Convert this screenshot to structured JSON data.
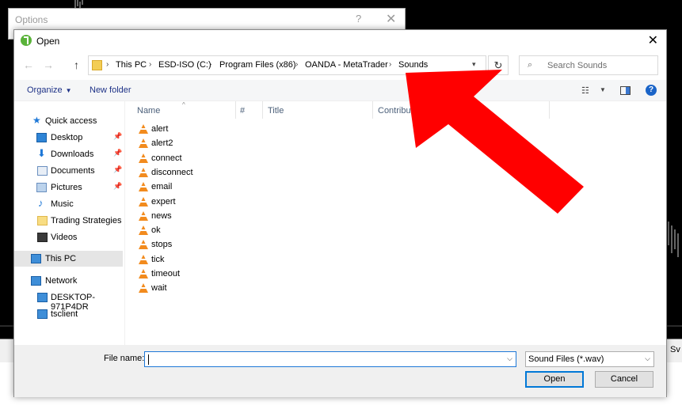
{
  "options_dialog": {
    "title": "Options",
    "help": "?",
    "close": "✕"
  },
  "open_dialog": {
    "title": "Open",
    "close": "✕",
    "nav": {
      "back": "←",
      "forward": "→",
      "up": "↑"
    },
    "breadcrumbs": [
      "This PC",
      "ESD-ISO (C:)",
      "Program Files (x86)",
      "OANDA - MetaTrader",
      "Sounds"
    ],
    "refresh": "↻",
    "search": {
      "placeholder": "Search Sounds",
      "icon": "⌕"
    },
    "toolbar": {
      "organize": "Organize",
      "new_folder": "New folder",
      "view": "☷",
      "help": "?"
    },
    "sidebar": {
      "items": [
        {
          "label": "Quick access",
          "icon": "star-icon"
        },
        {
          "label": "Desktop",
          "icon": "desktop-icon",
          "pinned": true
        },
        {
          "label": "Downloads",
          "icon": "download-icon",
          "pinned": true
        },
        {
          "label": "Documents",
          "icon": "document-icon",
          "pinned": true
        },
        {
          "label": "Pictures",
          "icon": "picture-icon",
          "pinned": true
        },
        {
          "label": "Music",
          "icon": "music-icon"
        },
        {
          "label": "Trading Strategies",
          "icon": "folder-icon"
        },
        {
          "label": "Videos",
          "icon": "video-icon"
        },
        {
          "label": "This PC",
          "icon": "computer-icon",
          "selected": true
        },
        {
          "label": "Network",
          "icon": "network-icon"
        },
        {
          "label": "DESKTOP-971P4DR",
          "icon": "computer-icon"
        },
        {
          "label": "tsclient",
          "icon": "computer-icon"
        }
      ]
    },
    "columns": [
      "Name",
      "#",
      "Title",
      "Contribut"
    ],
    "files": [
      "alert",
      "alert2",
      "connect",
      "disconnect",
      "email",
      "expert",
      "news",
      "ok",
      "stops",
      "tick",
      "timeout",
      "wait"
    ],
    "filename": {
      "label": "File name:",
      "value": ""
    },
    "filetype": {
      "selected": "Sound Files (*.wav)"
    },
    "buttons": {
      "open": "Open",
      "cancel": "Cancel"
    }
  },
  "background": {
    "tab_label": "Sv"
  },
  "colors": {
    "accent": "#0078d7",
    "arrow": "#ff0000",
    "vlc": "#f28b1e"
  }
}
